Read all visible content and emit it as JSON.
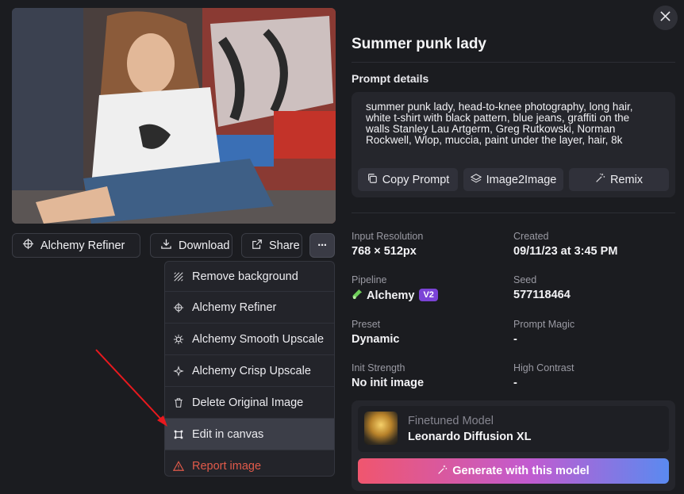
{
  "image": {
    "alt": "Summer punk lady"
  },
  "actions": {
    "alchemy_refiner": "Alchemy Refiner",
    "download": "Download",
    "share": "Share",
    "more": "···"
  },
  "menu": {
    "items": [
      {
        "label": "Remove background",
        "icon": "remove-background-icon"
      },
      {
        "label": "Alchemy Refiner",
        "icon": "alchemy-refiner-icon"
      },
      {
        "label": "Alchemy Smooth Upscale",
        "icon": "smooth-upscale-icon"
      },
      {
        "label": "Alchemy Crisp Upscale",
        "icon": "crisp-upscale-icon"
      },
      {
        "label": "Delete Original Image",
        "icon": "trash-icon"
      },
      {
        "label": "Edit in canvas",
        "icon": "canvas-icon"
      },
      {
        "label": "Report image",
        "icon": "warning-icon"
      }
    ]
  },
  "details": {
    "title": "Summer punk lady",
    "prompt_heading": "Prompt details",
    "prompt_lines": [
      "summer punk lady, head-to-knee photography, long hair,",
      "white t-shirt with black pattern, blue jeans, graffiti on the",
      "walls Stanley Lau Artgerm, Greg Rutkowski, Norman",
      "Rockwell, Wlop, muccia, paint under the layer, hair, 8k"
    ],
    "copy_prompt": "Copy Prompt",
    "image2image": "Image2Image",
    "remix": "Remix"
  },
  "info": {
    "input_resolution_label": "Input Resolution",
    "input_resolution": "768 × 512px",
    "created_label": "Created",
    "created": "09/11/23 at 3:45 PM",
    "pipeline_label": "Pipeline",
    "pipeline": "Alchemy",
    "pipeline_badge": "V2",
    "seed_label": "Seed",
    "seed": "577118464",
    "preset_label": "Preset",
    "preset": "Dynamic",
    "prompt_magic_label": "Prompt Magic",
    "prompt_magic": "-",
    "init_strength_label": "Init Strength",
    "init_strength": "No init image",
    "high_contrast_label": "High Contrast",
    "high_contrast": "-"
  },
  "model": {
    "label": "Finetuned Model",
    "name": "Leonardo Diffusion XL",
    "generate": "Generate with this model"
  },
  "colors": {
    "background": "#1b1c20",
    "accent_gradient_start": "#f0566e",
    "accent_gradient_end": "#5a8af0",
    "danger": "#e15a4a",
    "badge": "#7b43d6"
  }
}
